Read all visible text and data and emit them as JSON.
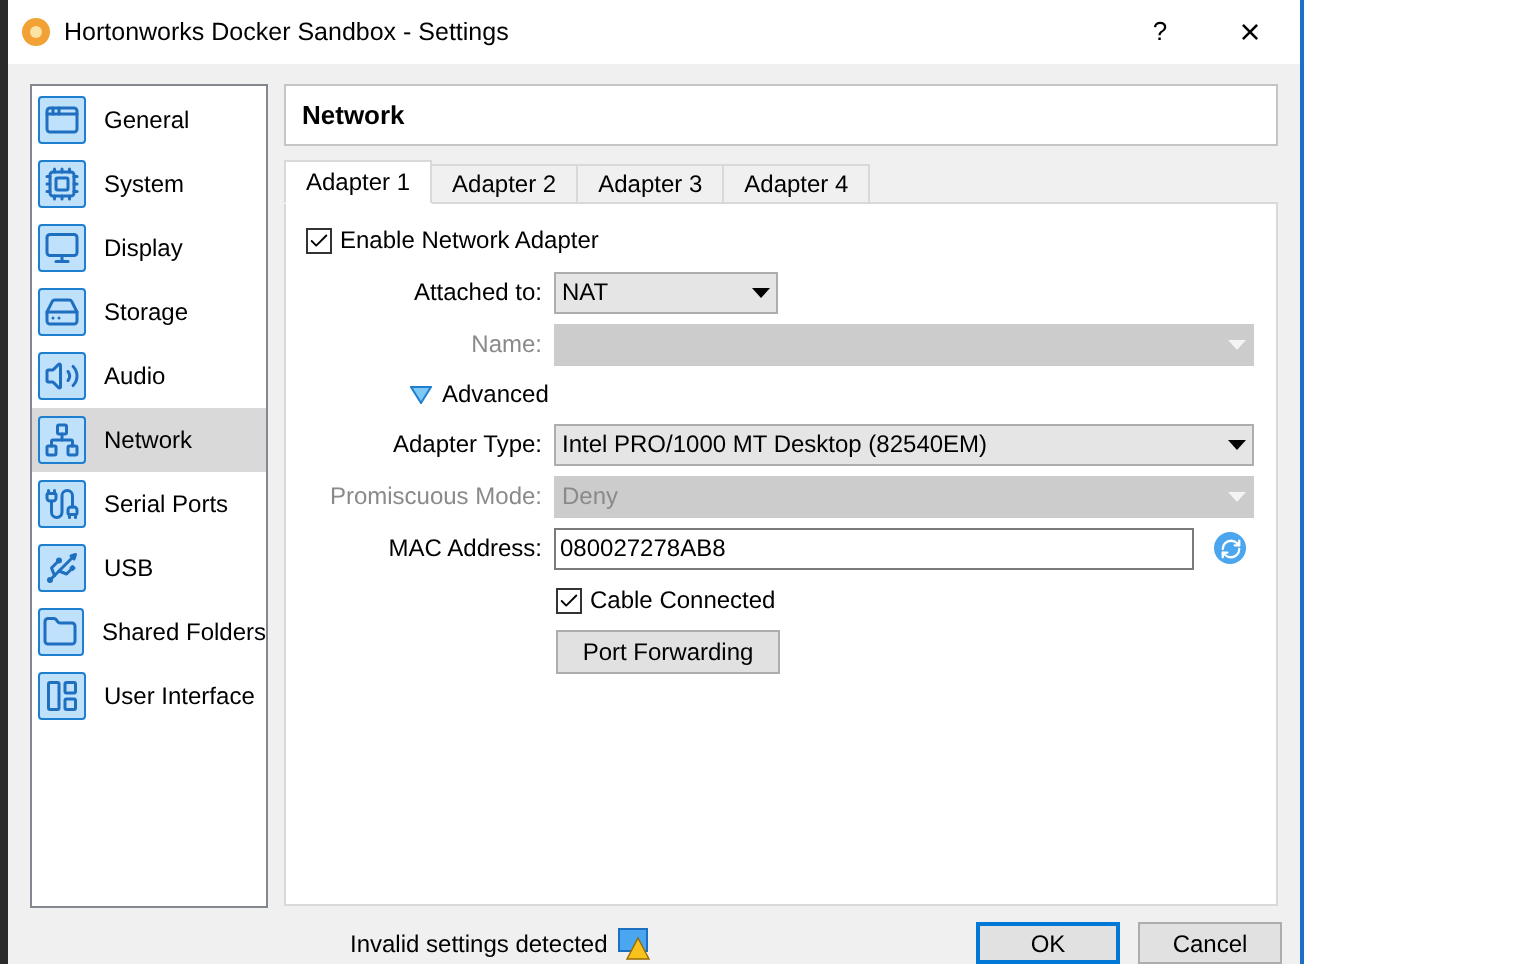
{
  "window": {
    "title": "Hortonworks Docker Sandbox - Settings",
    "help": "?",
    "close": "×"
  },
  "sidebar": {
    "items": [
      {
        "label": "General",
        "selected": false
      },
      {
        "label": "System",
        "selected": false
      },
      {
        "label": "Display",
        "selected": false
      },
      {
        "label": "Storage",
        "selected": false
      },
      {
        "label": "Audio",
        "selected": false
      },
      {
        "label": "Network",
        "selected": true
      },
      {
        "label": "Serial Ports",
        "selected": false
      },
      {
        "label": "USB",
        "selected": false
      },
      {
        "label": "Shared Folders",
        "selected": false
      },
      {
        "label": "User Interface",
        "selected": false
      }
    ]
  },
  "page_title": "Network",
  "tabs": [
    {
      "label": "Adapter 1",
      "selected": true
    },
    {
      "label": "Adapter 2",
      "selected": false
    },
    {
      "label": "Adapter 3",
      "selected": false
    },
    {
      "label": "Adapter 4",
      "selected": false
    }
  ],
  "form": [
    {
      "kind": "checkbox",
      "label": "Enable Network Adapter",
      "checked": true,
      "indented": false
    },
    {
      "kind": "select",
      "label": "Attached to:",
      "value": "NAT",
      "disabled": false,
      "wide": false
    },
    {
      "kind": "select",
      "label": "Name:",
      "disabled": true,
      "wide": true
    },
    {
      "kind": "expander",
      "label": "Advanced",
      "expanded": true
    },
    {
      "kind": "select",
      "label": "Adapter Type:",
      "value": "Intel PRO/1000 MT Desktop (82540EM)",
      "disabled": false,
      "wide": true
    },
    {
      "kind": "select",
      "label": "Promiscuous Mode:",
      "value": "Deny",
      "disabled": true,
      "wide": true
    },
    {
      "kind": "field",
      "label": "MAC Address:",
      "value": "080027278AB8"
    },
    {
      "kind": "checkbox",
      "label": "Cable Connected",
      "checked": true,
      "indented": true
    },
    {
      "kind": "button",
      "label": "Port Forwarding"
    }
  ],
  "status": {
    "message": "Invalid settings detected"
  },
  "buttons": [
    {
      "label": "OK",
      "default": true
    },
    {
      "label": "Cancel",
      "default": false
    }
  ]
}
